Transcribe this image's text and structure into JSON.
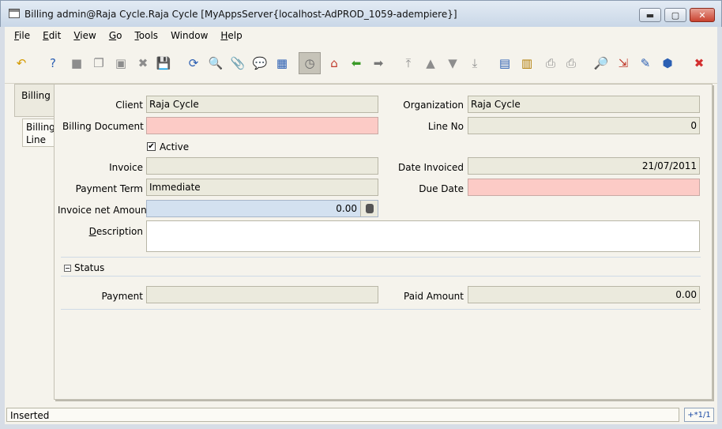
{
  "window": {
    "title": "Billing  admin@Raja Cycle.Raja Cycle [MyAppsServer{localhost-AdPROD_1059-adempiere}]",
    "min_glyph": "▬",
    "max_glyph": "▢",
    "close_glyph": "✕"
  },
  "menu": [
    {
      "key": "F",
      "rest": "ile"
    },
    {
      "key": "E",
      "rest": "dit"
    },
    {
      "key": "V",
      "rest": "iew"
    },
    {
      "key": "G",
      "rest": "o"
    },
    {
      "key": "T",
      "rest": "ools"
    },
    {
      "key": "",
      "rest": "Window"
    },
    {
      "key": "H",
      "rest": "elp"
    }
  ],
  "toolbar": [
    {
      "name": "undo-icon",
      "glyph": "↶",
      "color": "#d49a00"
    },
    {
      "name": "help-icon",
      "glyph": "?",
      "color": "#2b5fb3"
    },
    {
      "name": "new-record-icon",
      "glyph": "■",
      "color": "#8d8d8d"
    },
    {
      "name": "copy-record-icon",
      "glyph": "❐",
      "color": "#8d8d8d"
    },
    {
      "name": "delete-record-icon",
      "glyph": "▣",
      "color": "#8d8d8d"
    },
    {
      "name": "delete-selection-icon",
      "glyph": "✖",
      "color": "#8d8d8d"
    },
    {
      "name": "save-icon",
      "glyph": "💾",
      "color": "#2b5fb3"
    },
    {
      "name": "refresh-icon",
      "glyph": "⟳",
      "color": "#2b5fb3"
    },
    {
      "name": "find-icon",
      "glyph": "🔍",
      "color": "#555555"
    },
    {
      "name": "attachment-icon",
      "glyph": "📎",
      "color": "#2b5fb3"
    },
    {
      "name": "chat-icon",
      "glyph": "💬",
      "color": "#555555"
    },
    {
      "name": "grid-toggle-icon",
      "glyph": "▦",
      "color": "#2b5fb3"
    },
    {
      "name": "history-icon",
      "glyph": "◷",
      "color": "#666666"
    },
    {
      "name": "home-icon",
      "glyph": "⌂",
      "color": "#c0392b"
    },
    {
      "name": "parent-record-icon",
      "glyph": "⬅",
      "color": "#3a9a27"
    },
    {
      "name": "detail-record-icon",
      "glyph": "➡",
      "color": "#777777"
    },
    {
      "name": "first-record-icon",
      "glyph": "⤒",
      "color": "#8d8d8d"
    },
    {
      "name": "previous-record-icon",
      "glyph": "▲",
      "color": "#8d8d8d"
    },
    {
      "name": "next-record-icon",
      "glyph": "▼",
      "color": "#8d8d8d"
    },
    {
      "name": "last-record-icon",
      "glyph": "⤓",
      "color": "#8d8d8d"
    },
    {
      "name": "report-icon",
      "glyph": "▤",
      "color": "#2b5fb3"
    },
    {
      "name": "archive-icon",
      "glyph": "▥",
      "color": "#b07a00"
    },
    {
      "name": "print-preview-icon",
      "glyph": "⎙",
      "color": "#8d8d8d"
    },
    {
      "name": "print-icon",
      "glyph": "⎙",
      "color": "#8d8d8d"
    },
    {
      "name": "zoom-across-icon",
      "glyph": "🔎",
      "color": "#2b5fb3"
    },
    {
      "name": "active-workflows-icon",
      "glyph": "⇲",
      "color": "#c0392b"
    },
    {
      "name": "product-info-icon",
      "glyph": "✎",
      "color": "#2b5fb3"
    },
    {
      "name": "process-icon",
      "glyph": "⬢",
      "color": "#2b5fb3"
    },
    {
      "name": "exit-icon",
      "glyph": "✖",
      "color": "#d32f2f"
    }
  ],
  "tabs": [
    {
      "label": "Billing"
    },
    {
      "label": "Billing Line"
    }
  ],
  "form": {
    "client_label": "Client",
    "client_value": "Raja Cycle",
    "organization_label": "Organization",
    "organization_value": "Raja Cycle",
    "billing_document_label": "Billing Document",
    "billing_document_value": "",
    "line_no_label": "Line No",
    "line_no_value": "0",
    "active_label": "Active",
    "active_check": "✔",
    "invoice_label": "Invoice",
    "invoice_value": "",
    "date_invoiced_label": "Date Invoiced",
    "date_invoiced_value": "21/07/2011",
    "payment_term_label": "Payment Term",
    "payment_term_value": "Immediate",
    "due_date_label": "Due Date",
    "due_date_value": "",
    "invoice_net_amount_label": "Invoice net Amount",
    "invoice_net_amount_value": "0.00",
    "description_label_key": "D",
    "description_label_rest": "escription",
    "description_value": "",
    "status_section": "Status",
    "payment_label": "Payment",
    "payment_value": "",
    "paid_amount_label": "Paid Amount",
    "paid_amount_value": "0.00"
  },
  "status": {
    "message": "Inserted",
    "record": "+*1/1"
  }
}
